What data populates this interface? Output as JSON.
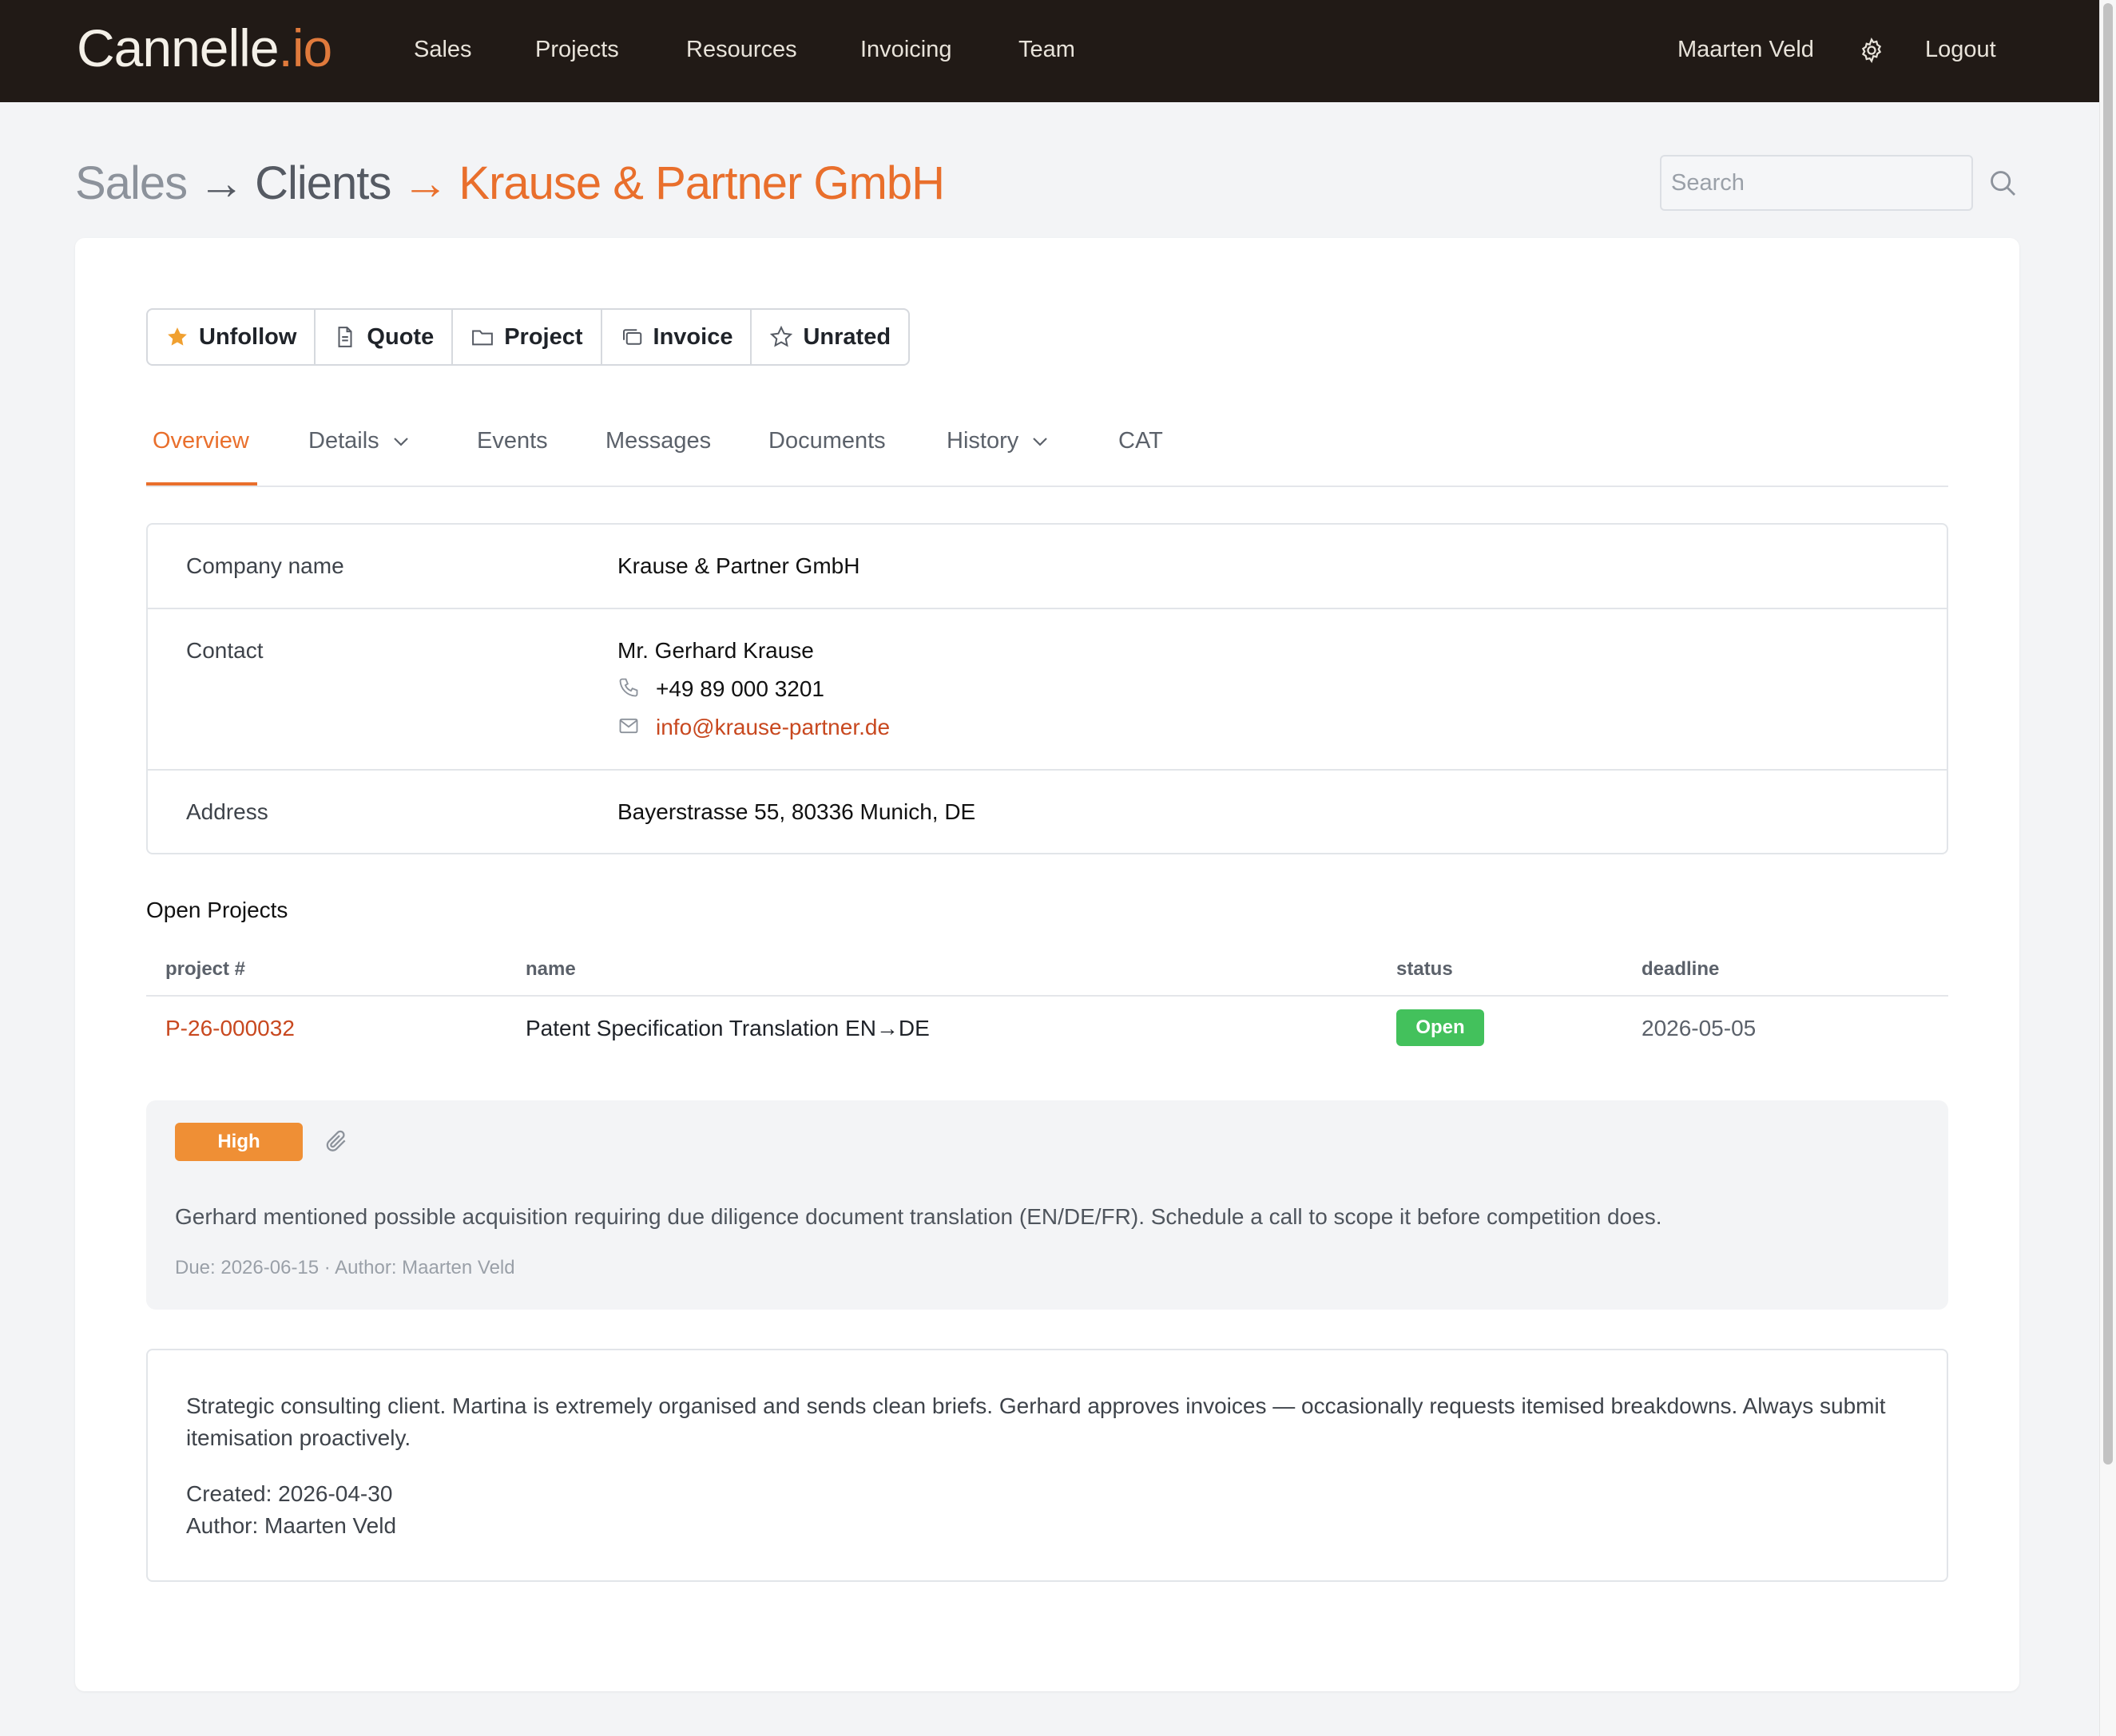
{
  "nav": {
    "brand_main": "Cannelle",
    "brand_tld": ".io",
    "items": [
      "Sales",
      "Projects",
      "Resources",
      "Invoicing",
      "Team"
    ],
    "user": "Maarten Veld",
    "logout": "Logout"
  },
  "breadcrumb": {
    "level1": "Sales",
    "level2": "Clients",
    "current": "Krause & Partner GmbH",
    "arrow": "→"
  },
  "search": {
    "placeholder": "Search"
  },
  "actions": {
    "unfollow": "Unfollow",
    "quote": "Quote",
    "project": "Project",
    "invoice": "Invoice",
    "unrated": "Unrated"
  },
  "tabs": {
    "overview": "Overview",
    "details": "Details",
    "events": "Events",
    "messages": "Messages",
    "documents": "Documents",
    "history": "History",
    "cat": "CAT"
  },
  "info": {
    "company_label": "Company name",
    "company_value": "Krause & Partner GmbH",
    "contact_label": "Contact",
    "contact_name": "Mr. Gerhard Krause",
    "contact_phone": "+49 89 000 3201",
    "contact_email": "info@krause-partner.de",
    "address_label": "Address",
    "address_value": "Bayerstrasse 55, 80336 Munich, DE"
  },
  "projects": {
    "title": "Open Projects",
    "headers": {
      "number": "project #",
      "name": "name",
      "status": "status",
      "deadline": "deadline"
    },
    "rows": [
      {
        "number": "P-26-000032",
        "name": "Patent Specification Translation EN→DE",
        "status": "Open",
        "deadline": "2026-05-05"
      }
    ]
  },
  "task": {
    "priority": "High",
    "text": "Gerhard mentioned possible acquisition requiring due diligence document translation (EN/DE/FR). Schedule a call to scope it before competition does.",
    "meta": "Due: 2026-06-15 · Author: Maarten Veld"
  },
  "notes": {
    "text": "Strategic consulting client. Martina is extremely organised and sends clean briefs. Gerhard approves invoices — occasionally requests itemised breakdowns. Always submit itemisation proactively.",
    "created": "Created: 2026-04-30",
    "author": "Author: Maarten Veld"
  },
  "colors": {
    "navbar": "#211a16",
    "accent": "#e96f2c",
    "link": "#c8481f",
    "status_open": "#43c15c",
    "priority_high": "#ef8f35"
  },
  "icons": {
    "unfollow": "star-filled-icon",
    "quote": "document-icon",
    "project": "folder-icon",
    "invoice": "copy-icon",
    "unrated": "star-outline-icon",
    "phone": "phone-icon",
    "email": "mail-icon",
    "attachment": "paperclip-icon",
    "settings": "gear-icon",
    "search": "search-icon"
  }
}
